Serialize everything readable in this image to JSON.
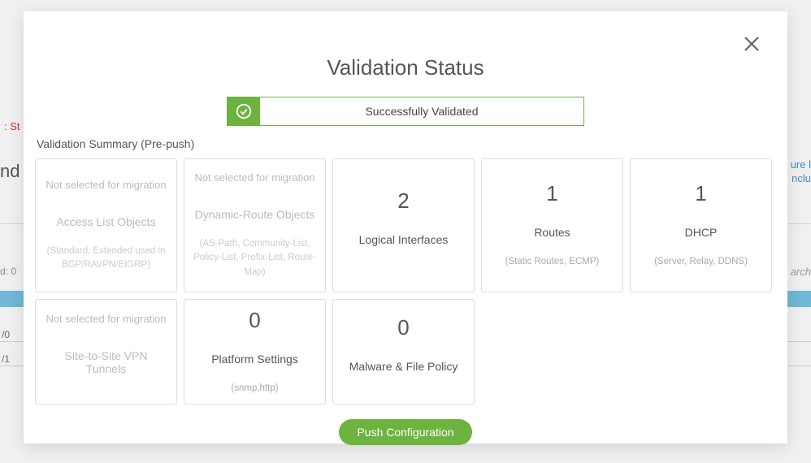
{
  "modal": {
    "title": "Validation Status",
    "banner_text": "Successfully Validated",
    "summary_label": "Validation Summary (Pre-push)",
    "push_button": "Push Configuration"
  },
  "tiles": [
    {
      "status": "Not selected for migration",
      "count": null,
      "title": "Access List Objects",
      "sub": "(Standard, Extended used in BGP/RAVPN/EIGRP)",
      "dim": true
    },
    {
      "status": "Not selected for migration",
      "count": null,
      "title": "Dynamic-Route Objects",
      "sub": "(AS-Path, Community-List, Policy-List, Prefix-List, Route-Map)",
      "dim": true
    },
    {
      "status": null,
      "count": "2",
      "title": "Logical Interfaces",
      "sub": "",
      "dim": false
    },
    {
      "status": null,
      "count": "1",
      "title": "Routes",
      "sub": "(Static Routes, ECMP)",
      "dim": false
    },
    {
      "status": null,
      "count": "1",
      "title": "DHCP",
      "sub": "(Server, Relay, DDNS)",
      "dim": false
    },
    {
      "status": "Not selected for migration",
      "count": null,
      "title": "Site-to-Site VPN Tunnels",
      "sub": "",
      "dim": true
    },
    {
      "status": null,
      "count": "0",
      "title": "Platform Settings",
      "sub": "(snmp,http)",
      "dim": false
    },
    {
      "status": null,
      "count": "0",
      "title": "Malware & File Policy",
      "sub": "",
      "dim": false
    }
  ],
  "backdrop": {
    "red_prefix": ": St",
    "nd": "nd",
    "d0": "d: 0",
    "v0": "/0",
    "v1": "/1",
    "ure": "ure l",
    "inclu": "nclu",
    "arch": "arch"
  }
}
